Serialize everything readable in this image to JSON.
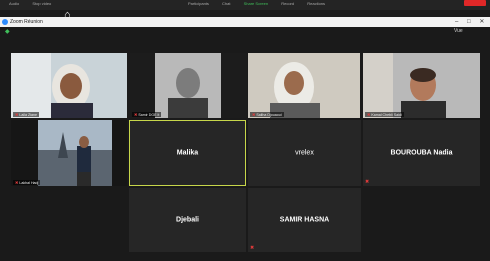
{
  "top_toolbar": {
    "left_items": [
      "Audio",
      "Stop video"
    ],
    "center_items": [
      "Participants",
      "Chat",
      "Share Screen",
      "Record",
      "Reactions"
    ],
    "active_center_index": 2
  },
  "window": {
    "title": "Zoom Réunion",
    "controls": [
      "minimize-icon",
      "maximize-icon",
      "close-icon"
    ]
  },
  "view": {
    "security_icon": "shield-icon",
    "label": "Vue"
  },
  "participants": [
    {
      "id": "p1",
      "name": "Laila Ziane",
      "muted": true,
      "video": true
    },
    {
      "id": "p2",
      "name": "Samir DGE lt",
      "muted": true,
      "video": true
    },
    {
      "id": "p3",
      "name": "Saliha Djouaoui",
      "muted": true,
      "video": true
    },
    {
      "id": "p4",
      "name": "Kamal Chebli Saidi",
      "muted": true,
      "video": true
    },
    {
      "id": "p5",
      "name": "Lakhal Hadj",
      "muted": true,
      "video": true
    },
    {
      "id": "p6",
      "name": "Malika",
      "muted": false,
      "video": false,
      "active_speaker": true
    },
    {
      "id": "p7",
      "name": "vrelex",
      "muted": false,
      "video": false
    },
    {
      "id": "p8",
      "name": "BOUROUBA Nadia",
      "muted": true,
      "video": false
    },
    {
      "id": "p9",
      "name": "Djebali",
      "muted": false,
      "video": false
    },
    {
      "id": "p10",
      "name": "SAMIR HASNA",
      "muted": true,
      "video": false
    }
  ],
  "colors": {
    "background": "#1a1a1a",
    "tile": "#262626",
    "active_speaker_border": "#c7d64a",
    "muted_icon": "#e23b3b",
    "share_screen": "#3fbf5a",
    "end_button": "#e02828"
  }
}
